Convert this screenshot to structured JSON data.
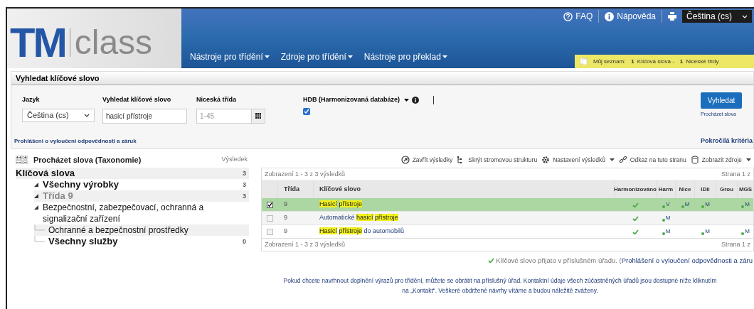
{
  "header": {
    "logo_main": "TM",
    "logo_sub": "class",
    "nav": [
      "Nástroje pro třídění",
      "Zdroje pro třídění",
      "Nástroje pro překlad"
    ],
    "top_links": [
      {
        "kind": "faq",
        "label": "FAQ"
      },
      {
        "kind": "help",
        "label": "Nápověda"
      }
    ],
    "language_select": "Čeština (cs)",
    "my_list": {
      "label": "Můj seznam:",
      "count_1": "1",
      "label_1": "Klíčová slova -",
      "count_2": "1",
      "label_2": "Niceské třídy"
    }
  },
  "search": {
    "title": "Vyhledat klíčové slovo",
    "language": {
      "label": "Jazyk",
      "value": "Čeština (cs)"
    },
    "keyword": {
      "label": "Vyhledat klíčové slovo",
      "value": "hasicí přístroje"
    },
    "nice_class": {
      "label": "Niceská třída",
      "placeholder": "1-45"
    },
    "hdb": {
      "label": "HDB (Harmonizovaná databáze)",
      "checked": true
    },
    "search_button": "Vyhledat",
    "browse_link": "Procházet slova",
    "disclaimer_link": "Prohlášeni o vyloučeni odpovědnosti a záruk",
    "advanced_link": "Pokročilá kritéria"
  },
  "tree": {
    "title": "Procházet slova (Taxonomie)",
    "result_label": "Výsledek",
    "items": [
      {
        "label": "Klíčová slova",
        "count": "3",
        "selected": true,
        "muted": false,
        "bold": true,
        "children": [
          {
            "label": "Všechny výrobky",
            "count": "3",
            "selected": false,
            "muted": false,
            "bold": true,
            "expanded": true,
            "children": [
              {
                "label": "Třída 9",
                "count": "3",
                "selected": true,
                "muted": true,
                "bold": true,
                "expanded": true,
                "children": [
                  {
                    "label": "Bezpečnostní, zabezpečovací, ochranná a signalizační zařízení",
                    "selected": false,
                    "muted": false,
                    "bold": false,
                    "expanded": true,
                    "children": [
                      {
                        "label": "Ochranné a bezpečnostní prostředky",
                        "selected": true,
                        "muted": false,
                        "bold": false
                      }
                    ]
                  }
                ]
              }
            ]
          },
          {
            "label": "Všechny služby",
            "count": "0",
            "selected": false,
            "muted": false,
            "bold": true
          }
        ]
      }
    ]
  },
  "toolbar": [
    {
      "kind": "close",
      "label": "Zavřít výsledky",
      "dropdown": false
    },
    {
      "kind": "tree",
      "label": "Skrýt stromovou strukturu",
      "dropdown": false
    },
    {
      "kind": "gear",
      "label": "Nastavení výsledků",
      "dropdown": true
    },
    {
      "kind": "link",
      "label": "Odkaz na tuto stranu",
      "dropdown": false
    },
    {
      "kind": "db",
      "label": "Zobrazit zdroje",
      "dropdown": true
    }
  ],
  "table": {
    "summary_top": "Zobrazení 1 - 3 z 3 výsledků",
    "page_top": "Strana 1 z",
    "summary_bottom": "Zobrazení 1 - 3 z 3 výsledků",
    "page_bottom": "Strana 1 z",
    "columns": [
      "Třída",
      "Klíčové slovo",
      "Harmonizováno",
      "Harm",
      "Nice",
      "IDIi",
      "Grou",
      "MGS"
    ],
    "rows": [
      {
        "selected": true,
        "checked": true,
        "class": "9",
        "keyword": [
          {
            "text": "Hasicí",
            "highlight": true
          },
          {
            "text": "přístroje",
            "highlight": true
          }
        ],
        "harmonized": true,
        "marks": {
          "harm": "V",
          "nice": "M",
          "idii": "M",
          "mgs": "M"
        }
      },
      {
        "selected": false,
        "checked": false,
        "class": "9",
        "keyword": [
          {
            "text": "Automatické",
            "highlight": false
          },
          {
            "text": "hasicí",
            "highlight": true
          },
          {
            "text": "přístroje",
            "highlight": true
          }
        ],
        "harmonized": true,
        "marks": {
          "harm": "M"
        }
      },
      {
        "selected": false,
        "checked": false,
        "class": "9",
        "keyword": [
          {
            "text": "Hasicí",
            "highlight": true
          },
          {
            "text": "přístroje",
            "highlight": true
          },
          {
            "text": "do automobilů",
            "highlight": false
          }
        ],
        "harmonized": true,
        "marks": {
          "harm": "M",
          "idii": "M",
          "mgs": "M"
        }
      }
    ]
  },
  "status": {
    "accepted": "Klíčové slovo přijato v příslušném úřadu. (",
    "link": "Prohlášení o vyloučení odpovědnosti a záru"
  },
  "note": [
    "Pokud chcete navrhnout doplnění výrazů pro třídění, můžete se obrátit na příslušný úřad. Kontaktní údaje všech zúčastněných úřadů jsou dostupné níže kliknutím",
    "na „Kontakt“. Veškeré obdržené návrhy vítáme a budou náležitě zváženy."
  ]
}
